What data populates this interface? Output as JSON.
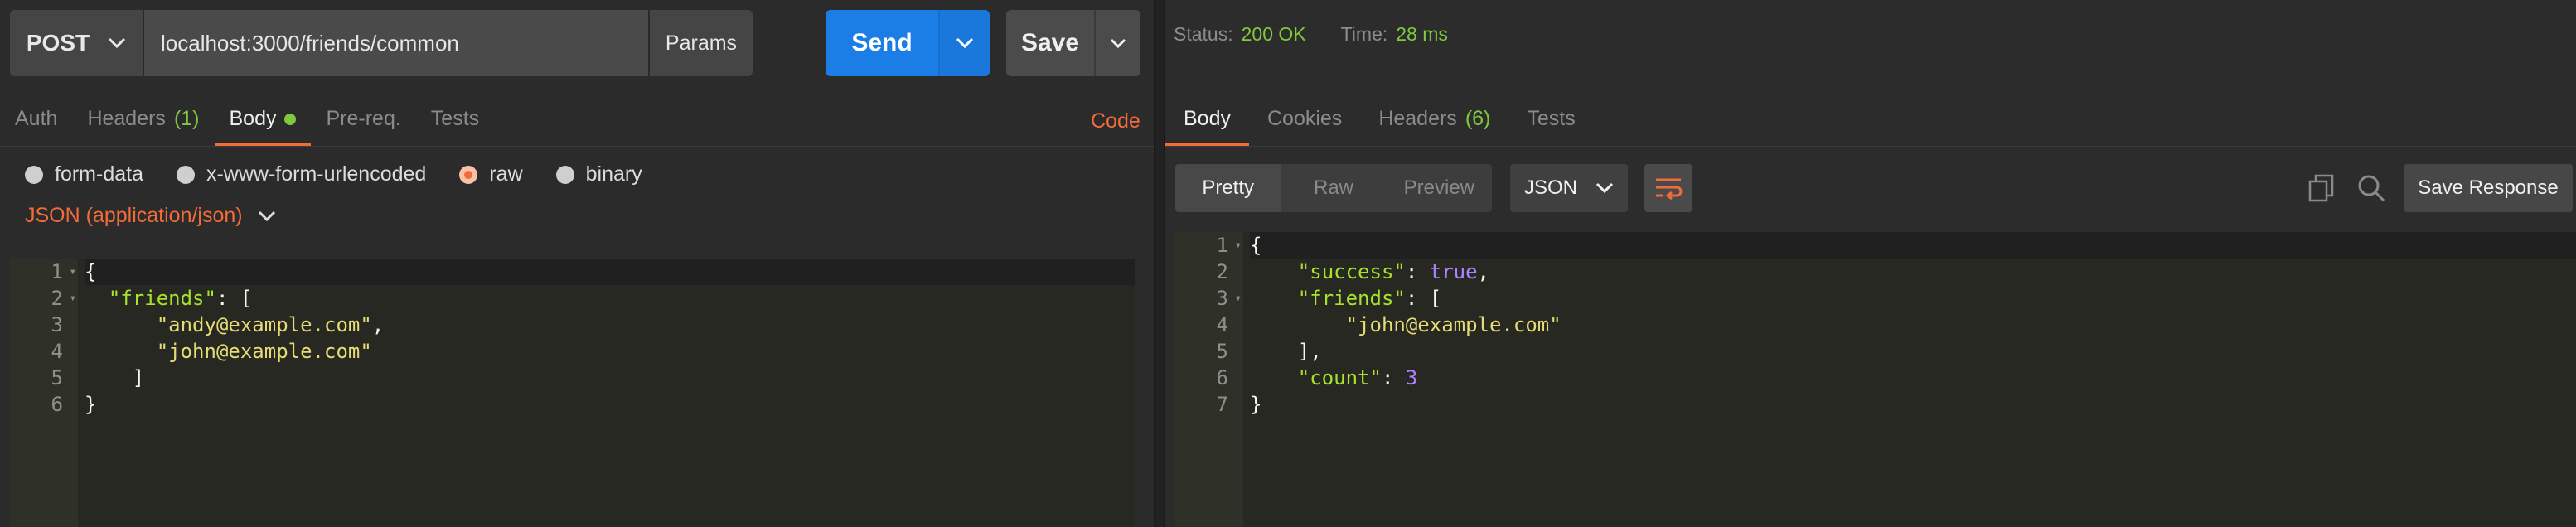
{
  "request": {
    "method": "POST",
    "url": "localhost:3000/friends/common",
    "params_label": "Params",
    "send_label": "Send",
    "save_label": "Save",
    "tabs": [
      {
        "label": "Auth",
        "count": ""
      },
      {
        "label": "Headers",
        "count": "(1)"
      },
      {
        "label": "Body",
        "count": ""
      },
      {
        "label": "Pre-req.",
        "count": ""
      },
      {
        "label": "Tests",
        "count": ""
      }
    ],
    "code_link": "Code",
    "body_types": [
      "form-data",
      "x-www-form-urlencoded",
      "raw",
      "binary"
    ],
    "selected_body_type": "raw",
    "content_type": "JSON (application/json)",
    "line_numbers": [
      "1",
      "2",
      "3",
      "4",
      "5",
      "6"
    ]
  },
  "response": {
    "status_label": "Status:",
    "status_value": "200 OK",
    "time_label": "Time:",
    "time_value": "28 ms",
    "tabs": [
      {
        "label": "Body",
        "count": ""
      },
      {
        "label": "Cookies",
        "count": ""
      },
      {
        "label": "Headers",
        "count": "(6)"
      },
      {
        "label": "Tests",
        "count": ""
      }
    ],
    "view_modes": [
      "Pretty",
      "Raw",
      "Preview"
    ],
    "format": "JSON",
    "save_response_label": "Save Response",
    "line_numbers": [
      "1",
      "2",
      "3",
      "4",
      "5",
      "6",
      "7"
    ]
  },
  "request_body_lines": [
    [
      "{"
    ],
    [
      "  ",
      "\"friends\"",
      ": ["
    ],
    [
      "      ",
      "\"andy@example.com\"",
      ","
    ],
    [
      "      ",
      "\"john@example.com\""
    ],
    [
      "    ]"
    ],
    [
      "}"
    ]
  ],
  "response_body_lines": [
    [
      "{"
    ],
    [
      "    ",
      "\"success\"",
      ": ",
      "true",
      ","
    ],
    [
      "    ",
      "\"friends\"",
      ": ["
    ],
    [
      "        ",
      "\"john@example.com\""
    ],
    [
      "    ],"
    ],
    [
      "    ",
      "\"count\"",
      ": ",
      "3"
    ],
    [
      "}"
    ]
  ],
  "colors": {
    "accent": "#f26b3a",
    "send": "#1b7ee6",
    "status_ok": "#7fc93d",
    "json_key": "#a6e22e",
    "json_string": "#e6db74",
    "json_literal": "#ae81ff"
  }
}
